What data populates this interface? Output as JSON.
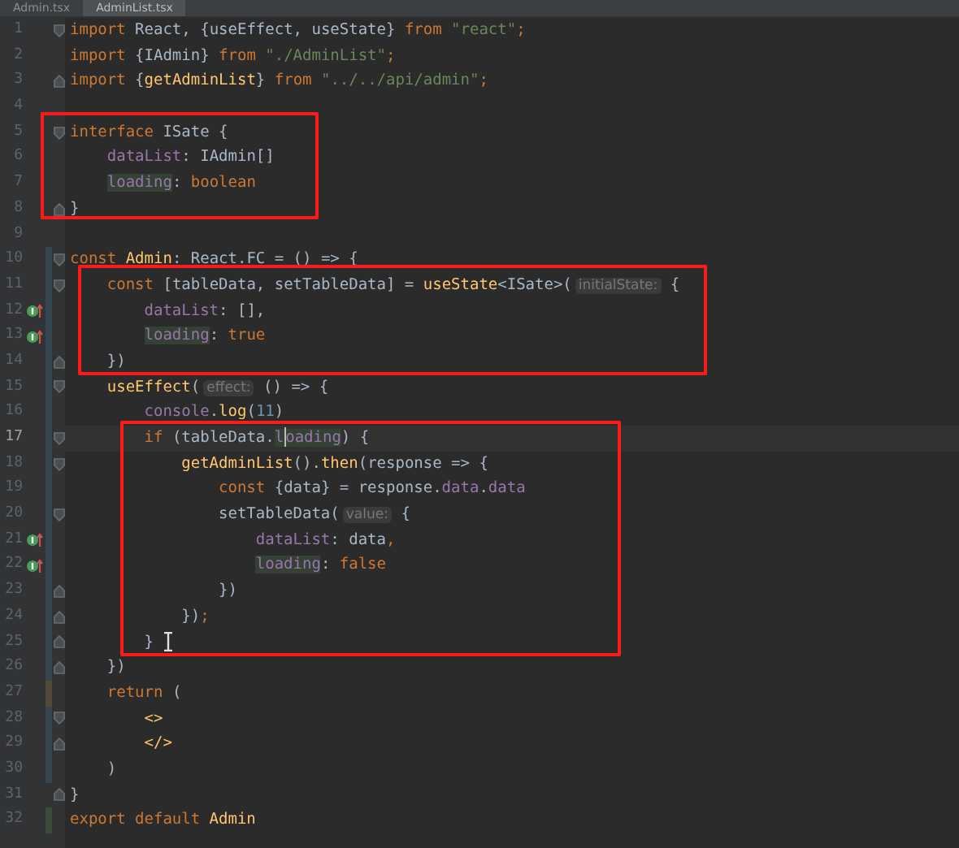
{
  "tabs": [
    {
      "label": "Admin.tsx",
      "selected": false
    },
    {
      "label": "AdminList.tsx",
      "selected": true
    }
  ],
  "lines": [
    {
      "number": "1",
      "fold_start": true,
      "fold_end": false,
      "marker": false,
      "current": false,
      "tokens": [
        {
          "kind": "keyword",
          "text": "import "
        },
        {
          "kind": "plain",
          "text": "React, {"
        },
        {
          "kind": "plain",
          "text": "useEffect, useState"
        },
        {
          "kind": "plain",
          "text": "} "
        },
        {
          "kind": "keyword",
          "text": "from "
        },
        {
          "kind": "string",
          "text": "\"react\""
        },
        {
          "kind": "keyword",
          "text": ";"
        }
      ]
    },
    {
      "number": "2",
      "fold_start": false,
      "fold_end": false,
      "marker": false,
      "current": false,
      "tokens": [
        {
          "kind": "keyword",
          "text": "import "
        },
        {
          "kind": "plain",
          "text": "{IAdmin} "
        },
        {
          "kind": "keyword",
          "text": "from "
        },
        {
          "kind": "string",
          "text": "\"./AdminList\""
        },
        {
          "kind": "keyword",
          "text": ";"
        }
      ]
    },
    {
      "number": "3",
      "fold_start": false,
      "fold_end": true,
      "marker": false,
      "current": false,
      "tokens": [
        {
          "kind": "keyword",
          "text": "import "
        },
        {
          "kind": "plain",
          "text": "{"
        },
        {
          "kind": "func",
          "text": "getAdminList"
        },
        {
          "kind": "plain",
          "text": "} "
        },
        {
          "kind": "keyword",
          "text": "from "
        },
        {
          "kind": "string",
          "text": "\"../../api/admin\""
        },
        {
          "kind": "keyword",
          "text": ";"
        }
      ]
    },
    {
      "number": "4",
      "fold_start": false,
      "fold_end": false,
      "marker": false,
      "current": false
    },
    {
      "number": "5",
      "fold_start": true,
      "fold_end": false,
      "marker": false,
      "current": false,
      "tokens": [
        {
          "kind": "keyword",
          "text": "interface "
        },
        {
          "kind": "plain",
          "text": "ISate {"
        }
      ]
    },
    {
      "number": "6",
      "fold_start": false,
      "fold_end": false,
      "marker": false,
      "current": false,
      "tokens": [
        {
          "kind": "property",
          "text": "    dataList"
        },
        {
          "kind": "plain",
          "text": ": IAdmin[]"
        }
      ]
    },
    {
      "number": "7",
      "fold_start": false,
      "fold_end": false,
      "marker": false,
      "current": false,
      "tokens": [
        {
          "kind": "usage",
          "text": "    loading"
        },
        {
          "kind": "plain",
          "text": ": "
        },
        {
          "kind": "keyword",
          "text": "boolean"
        }
      ]
    },
    {
      "number": "8",
      "fold_start": false,
      "fold_end": true,
      "marker": false,
      "current": false,
      "tokens": [
        {
          "kind": "plain",
          "text": "}"
        }
      ]
    },
    {
      "number": "9",
      "fold_start": false,
      "fold_end": false,
      "marker": false,
      "current": false
    },
    {
      "number": "10",
      "fold_start": true,
      "fold_end": false,
      "color": "#374752",
      "marker": false,
      "current": false,
      "tokens": [
        {
          "kind": "keyword",
          "text": "const "
        },
        {
          "kind": "func",
          "text": "Admin"
        },
        {
          "kind": "plain",
          "text": ": React.FC = () => {"
        }
      ]
    },
    {
      "number": "11",
      "fold_start": true,
      "fold_end": false,
      "color": "#374752",
      "marker": false,
      "current": false,
      "tokens": [
        {
          "kind": "keyword",
          "text": "    const "
        },
        {
          "kind": "plain",
          "text": "[tableData, setTableData] = "
        },
        {
          "kind": "func",
          "text": "useState"
        },
        {
          "kind": "plain",
          "text": "<ISate>("
        },
        {
          "kind": "hint",
          "text": "initialState:"
        },
        {
          "kind": "plain",
          "text": " {"
        }
      ]
    },
    {
      "number": "12",
      "fold_start": false,
      "fold_end": false,
      "color": "#374752",
      "marker": true,
      "current": false,
      "tokens": [
        {
          "kind": "property",
          "text": "        dataList"
        },
        {
          "kind": "plain",
          "text": ": [],"
        }
      ]
    },
    {
      "number": "13",
      "fold_start": false,
      "fold_end": false,
      "color": "#374752",
      "marker": true,
      "current": false,
      "tokens": [
        {
          "kind": "usage",
          "text": "        loading"
        },
        {
          "kind": "plain",
          "text": ": "
        },
        {
          "kind": "keyword",
          "text": "true"
        }
      ]
    },
    {
      "number": "14",
      "fold_start": false,
      "fold_end": true,
      "color": "#374752",
      "marker": false,
      "current": false,
      "tokens": [
        {
          "kind": "plain",
          "text": "    })"
        }
      ]
    },
    {
      "number": "15",
      "fold_start": true,
      "fold_end": false,
      "color": "#374752",
      "marker": false,
      "current": false,
      "tokens": [
        {
          "kind": "func",
          "text": "    useEffect"
        },
        {
          "kind": "plain",
          "text": "("
        },
        {
          "kind": "hint",
          "text": "effect:"
        },
        {
          "kind": "plain",
          "text": " () => {"
        }
      ]
    },
    {
      "number": "16",
      "fold_start": false,
      "fold_end": false,
      "color": "#374752",
      "marker": false,
      "current": false,
      "tokens": [
        {
          "kind": "property",
          "text": "        console"
        },
        {
          "kind": "plain",
          "text": "."
        },
        {
          "kind": "func",
          "text": "log"
        },
        {
          "kind": "plain",
          "text": "("
        },
        {
          "kind": "number",
          "text": "11"
        },
        {
          "kind": "plain",
          "text": ")"
        }
      ]
    },
    {
      "number": "17",
      "fold_start": true,
      "fold_end": false,
      "color": "#374752",
      "marker": false,
      "current": true,
      "tokens": [
        {
          "kind": "keyword",
          "text": "        if "
        },
        {
          "kind": "plain",
          "text": "(tableData."
        },
        {
          "kind": "usage",
          "text": "l"
        },
        {
          "kind": "caret"
        },
        {
          "kind": "usage",
          "text": "oading"
        },
        {
          "kind": "plain",
          "text": ") {"
        }
      ]
    },
    {
      "number": "18",
      "fold_start": true,
      "fold_end": false,
      "color": "#374752",
      "marker": false,
      "current": false,
      "tokens": [
        {
          "kind": "func",
          "text": "            getAdminList"
        },
        {
          "kind": "plain",
          "text": "()."
        },
        {
          "kind": "func",
          "text": "then"
        },
        {
          "kind": "plain",
          "text": "(response => {"
        }
      ]
    },
    {
      "number": "19",
      "fold_start": false,
      "fold_end": false,
      "color": "#374752",
      "marker": false,
      "current": false,
      "tokens": [
        {
          "kind": "keyword",
          "text": "                const "
        },
        {
          "kind": "plain",
          "text": "{data} = response."
        },
        {
          "kind": "property",
          "text": "data"
        },
        {
          "kind": "plain",
          "text": "."
        },
        {
          "kind": "property",
          "text": "data"
        }
      ]
    },
    {
      "number": "20",
      "fold_start": true,
      "fold_end": false,
      "color": "#374752",
      "marker": false,
      "current": false,
      "tokens": [
        {
          "kind": "plain",
          "text": "                setTableData("
        },
        {
          "kind": "hint",
          "text": "value:"
        },
        {
          "kind": "plain",
          "text": " {"
        }
      ]
    },
    {
      "number": "21",
      "fold_start": false,
      "fold_end": false,
      "color": "#374752",
      "marker": true,
      "current": false,
      "tokens": [
        {
          "kind": "property",
          "text": "                    dataList"
        },
        {
          "kind": "plain",
          "text": ": data"
        },
        {
          "kind": "keyword",
          "text": ","
        }
      ]
    },
    {
      "number": "22",
      "fold_start": false,
      "fold_end": false,
      "color": "#374752",
      "marker": true,
      "current": false,
      "tokens": [
        {
          "kind": "usage",
          "text": "                    loading"
        },
        {
          "kind": "plain",
          "text": ": "
        },
        {
          "kind": "keyword",
          "text": "false"
        }
      ]
    },
    {
      "number": "23",
      "fold_start": false,
      "fold_end": true,
      "color": "#374752",
      "marker": false,
      "current": false,
      "tokens": [
        {
          "kind": "plain",
          "text": "                })"
        }
      ]
    },
    {
      "number": "24",
      "fold_start": false,
      "fold_end": true,
      "color": "#374752",
      "marker": false,
      "current": false,
      "tokens": [
        {
          "kind": "plain",
          "text": "            })"
        },
        {
          "kind": "keyword",
          "text": ";"
        }
      ]
    },
    {
      "number": "25",
      "fold_start": false,
      "fold_end": true,
      "color": "#374752",
      "marker": false,
      "current": false,
      "tokens": [
        {
          "kind": "plain",
          "text": "        }"
        },
        {
          "kind": "pointer"
        }
      ]
    },
    {
      "number": "26",
      "fold_start": false,
      "fold_end": true,
      "color": "#374752",
      "marker": false,
      "current": false,
      "tokens": [
        {
          "kind": "plain",
          "text": "    })"
        }
      ]
    },
    {
      "number": "27",
      "fold_start": false,
      "fold_end": false,
      "color": "#554a38",
      "marker": false,
      "current": false,
      "tokens": [
        {
          "kind": "keyword",
          "text": "    return "
        },
        {
          "kind": "plain",
          "text": "("
        }
      ]
    },
    {
      "number": "28",
      "fold_start": true,
      "fold_end": false,
      "color": "#374752",
      "marker": false,
      "current": false,
      "tokens": [
        {
          "kind": "func",
          "text": "        <>"
        }
      ]
    },
    {
      "number": "29",
      "fold_start": false,
      "fold_end": true,
      "color": "#374752",
      "marker": false,
      "current": false,
      "tokens": [
        {
          "kind": "func",
          "text": "        </>"
        }
      ]
    },
    {
      "number": "30",
      "fold_start": false,
      "fold_end": false,
      "color": "#374752",
      "marker": false,
      "current": false,
      "tokens": [
        {
          "kind": "plain",
          "text": "    )"
        }
      ]
    },
    {
      "number": "31",
      "fold_start": false,
      "fold_end": true,
      "marker": false,
      "current": false,
      "tokens": [
        {
          "kind": "plain",
          "text": "}"
        }
      ]
    },
    {
      "number": "32",
      "fold_start": false,
      "fold_end": false,
      "color": "#384c38",
      "marker": false,
      "current": false,
      "tokens": [
        {
          "kind": "keyword",
          "text": "export default "
        },
        {
          "kind": "func",
          "text": "Admin"
        }
      ]
    }
  ]
}
